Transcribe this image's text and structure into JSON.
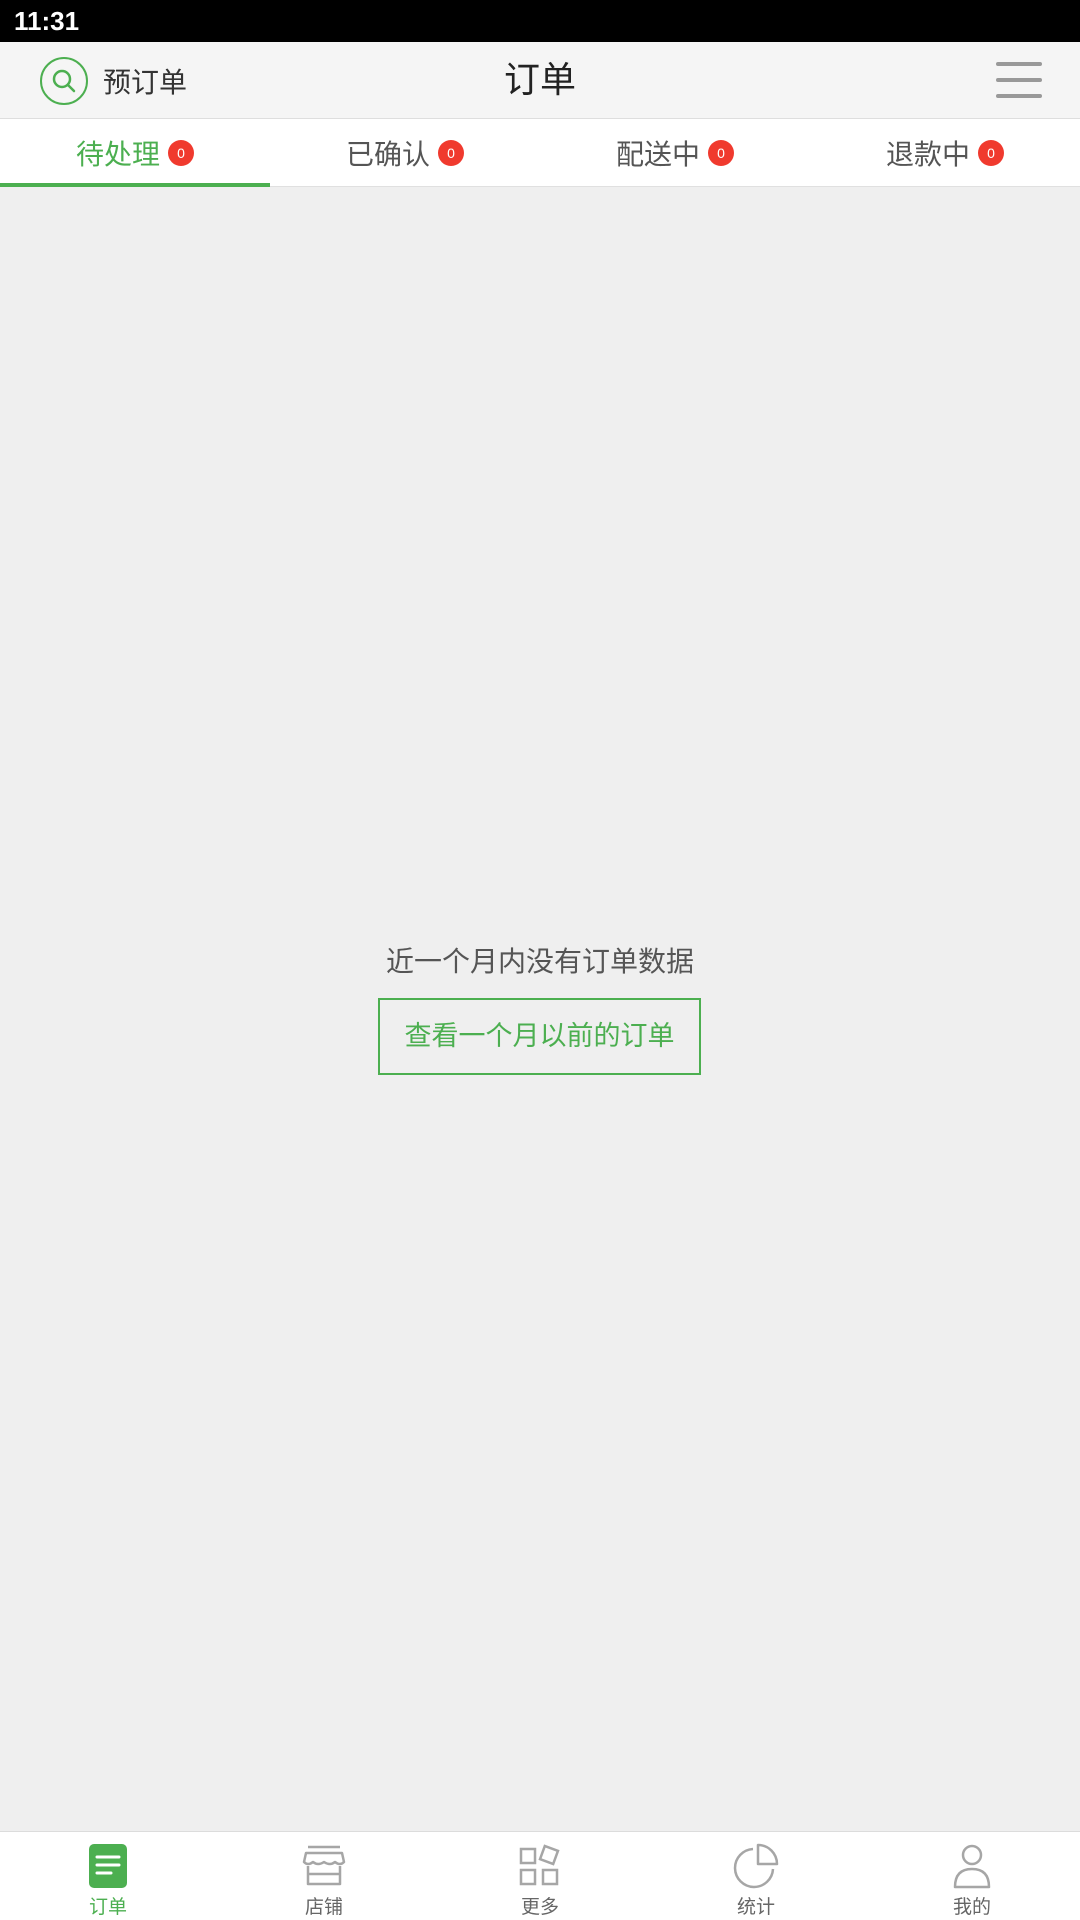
{
  "status_bar": {
    "time": "11:31"
  },
  "header": {
    "preorder_label": "预订单",
    "title": "订单",
    "search_icon": "search-icon",
    "menu_icon": "hamburger-menu-icon"
  },
  "tabs": [
    {
      "label": "待处理",
      "count": "0",
      "active": true
    },
    {
      "label": "已确认",
      "count": "0",
      "active": false
    },
    {
      "label": "配送中",
      "count": "0",
      "active": false
    },
    {
      "label": "退款中",
      "count": "0",
      "active": false
    }
  ],
  "empty_state": {
    "message": "近一个月内没有订单数据",
    "button_label": "查看一个月以前的订单"
  },
  "bottom_nav": [
    {
      "label": "订单",
      "icon": "order-document-icon",
      "active": true
    },
    {
      "label": "店铺",
      "icon": "store-icon",
      "active": false
    },
    {
      "label": "更多",
      "icon": "grid-more-icon",
      "active": false
    },
    {
      "label": "统计",
      "icon": "pie-chart-icon",
      "active": false
    },
    {
      "label": "我的",
      "icon": "person-icon",
      "active": false
    }
  ],
  "colors": {
    "accent": "#4caf50",
    "badge": "#f03a2e",
    "background": "#efefef",
    "inactive_icon": "#a6a6a6"
  }
}
